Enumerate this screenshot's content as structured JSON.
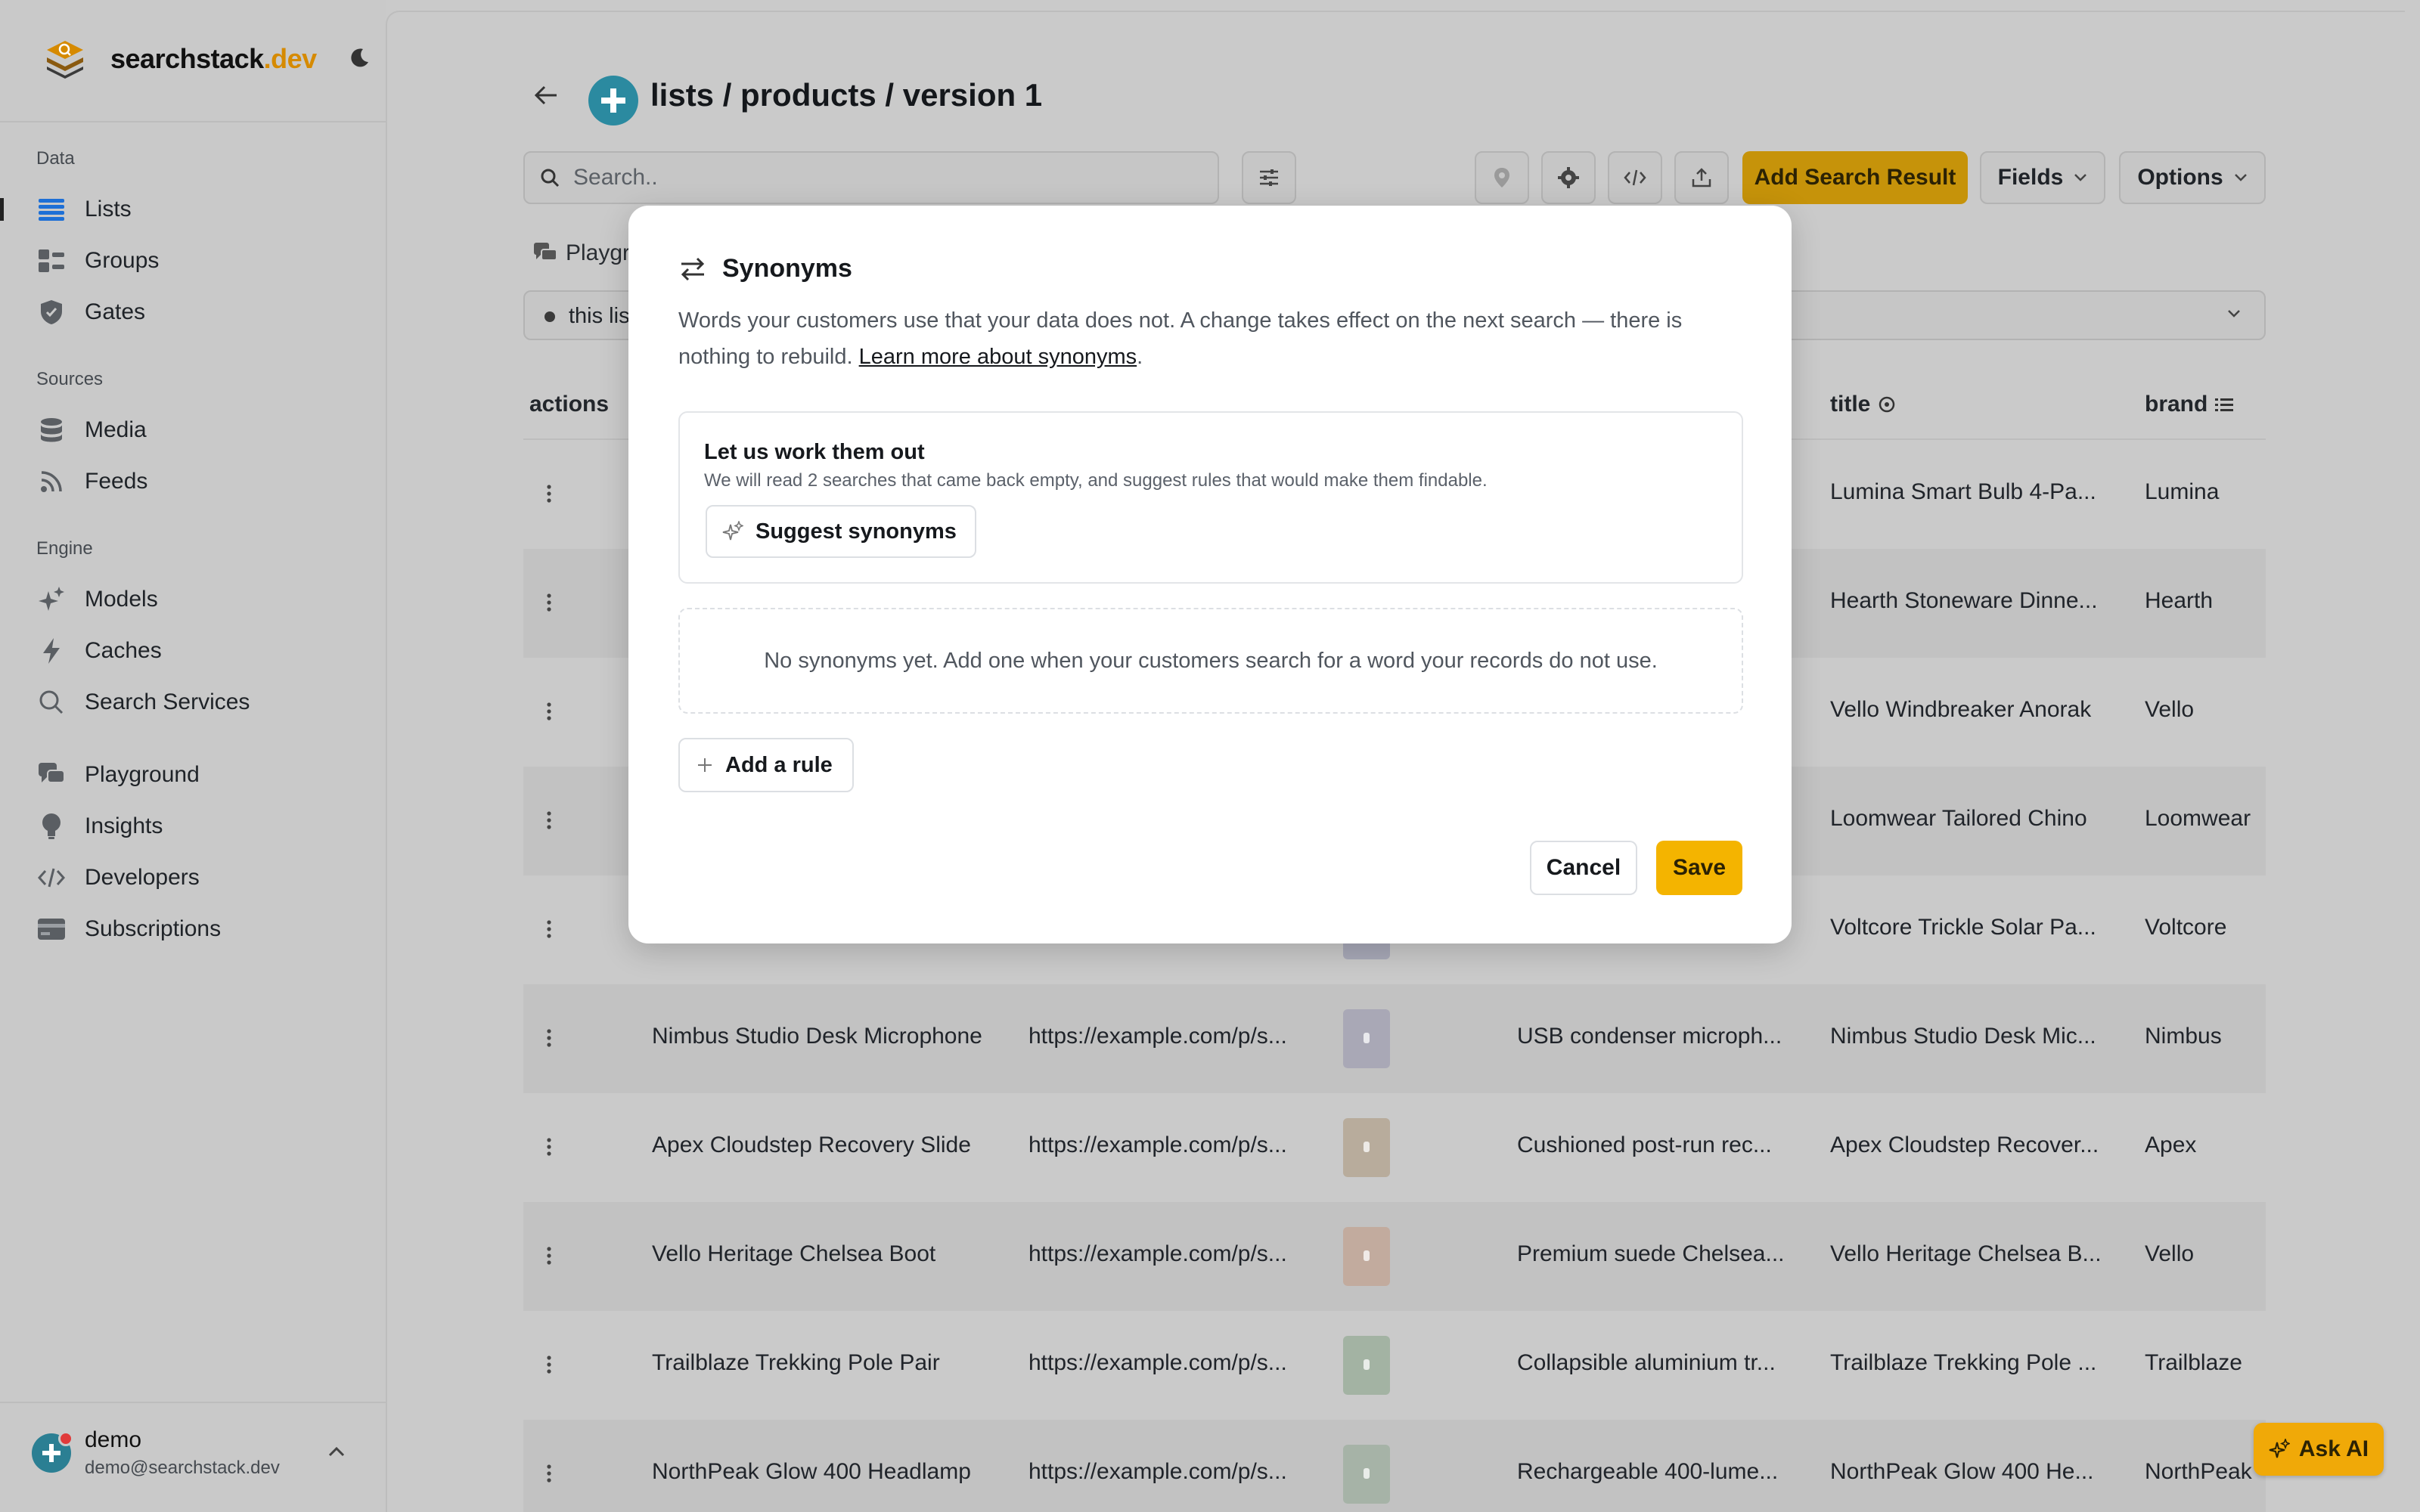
{
  "brand": {
    "name_main": "searchstack",
    "name_suffix": ".dev"
  },
  "sidebar": {
    "sections": {
      "data": "Data",
      "sources": "Sources",
      "engine": "Engine"
    },
    "items": [
      {
        "label": "Lists",
        "icon": "list-icon",
        "active": true
      },
      {
        "label": "Groups",
        "icon": "groups-icon"
      },
      {
        "label": "Gates",
        "icon": "shield-icon"
      },
      {
        "label": "Media",
        "icon": "database-icon"
      },
      {
        "label": "Feeds",
        "icon": "rss-icon"
      },
      {
        "label": "Models",
        "icon": "sparkles-icon"
      },
      {
        "label": "Caches",
        "icon": "bolt-icon"
      },
      {
        "label": "Search Services",
        "icon": "search-icon"
      },
      {
        "label": "Playground",
        "icon": "chat-icon"
      },
      {
        "label": "Insights",
        "icon": "bulb-icon"
      },
      {
        "label": "Developers",
        "icon": "code-icon"
      },
      {
        "label": "Subscriptions",
        "icon": "card-icon"
      }
    ],
    "user": {
      "name": "demo",
      "email": "demo@searchstack.dev"
    }
  },
  "header": {
    "title": "lists / products / version 1"
  },
  "toolbar": {
    "search_placeholder": "Search..",
    "add_label": "Add Search Result",
    "fields_label": "Fields",
    "options_label": "Options"
  },
  "tabs": {
    "playground_partial": "Playgr"
  },
  "filter": {
    "chip_partial": "this lis"
  },
  "table": {
    "headers": {
      "actions": "actions",
      "title": "title",
      "brand": "brand"
    },
    "rows": [
      {
        "name": "",
        "url": "",
        "desc": "",
        "title": "Lumina Smart Bulb 4-Pa...",
        "brand": "Lumina",
        "thumb": "#c7c7c7"
      },
      {
        "name": "",
        "url": "",
        "desc": "",
        "title": "Hearth Stoneware Dinne...",
        "brand": "Hearth",
        "thumb": "#c7c7c7"
      },
      {
        "name": "",
        "url": "",
        "desc": "",
        "title": "Vello Windbreaker Anorak",
        "brand": "Vello",
        "thumb": "#c7c7c7"
      },
      {
        "name": "",
        "url": "",
        "desc": "",
        "title": "Loomwear Tailored Chino",
        "brand": "Loomwear",
        "thumb": "#c7c7c7"
      },
      {
        "name": "",
        "url": "",
        "desc": "",
        "title": "Voltcore Trickle Solar Pa...",
        "brand": "Voltcore",
        "thumb": "#a8a9b8"
      },
      {
        "name": "Nimbus Studio Desk Microphone",
        "url": "https://example.com/p/s...",
        "desc": "USB condenser microph...",
        "title": "Nimbus Studio Desk Mic...",
        "brand": "Nimbus",
        "thumb": "#a9a8b6"
      },
      {
        "name": "Apex Cloudstep Recovery Slide",
        "url": "https://example.com/p/s...",
        "desc": "Cushioned post-run rec...",
        "title": "Apex Cloudstep Recover...",
        "brand": "Apex",
        "thumb": "#b8ac9c"
      },
      {
        "name": "Vello Heritage Chelsea Boot",
        "url": "https://example.com/p/s...",
        "desc": "Premium suede Chelsea...",
        "title": "Vello Heritage Chelsea B...",
        "brand": "Vello",
        "thumb": "#c2ab9e"
      },
      {
        "name": "Trailblaze Trekking Pole Pair",
        "url": "https://example.com/p/s...",
        "desc": "Collapsible aluminium tr...",
        "title": "Trailblaze Trekking Pole ...",
        "brand": "Trailblaze",
        "thumb": "#a3b3a3"
      },
      {
        "name": "NorthPeak Glow 400 Headlamp",
        "url": "https://example.com/p/s...",
        "desc": "Rechargeable 400-lume...",
        "title": "NorthPeak Glow 400 He...",
        "brand": "NorthPeak",
        "thumb": "#a6b3a7"
      }
    ]
  },
  "modal": {
    "title": "Synonyms",
    "desc": "Words your customers use that your data does not. A change takes effect on the next search — there is nothing to rebuild.",
    "learn_more": "Learn more about synonyms",
    "desc_end": ".",
    "card_heading": "Let us work them out",
    "card_sub": "We will read 2 searches that came back empty, and suggest rules that would make them findable.",
    "suggest_label": "Suggest synonyms",
    "empty_text": "No synonyms yet. Add one when your customers search for a word your records do not use.",
    "add_rule_label": "Add a rule",
    "cancel_label": "Cancel",
    "save_label": "Save"
  },
  "ask_ai": {
    "label": "Ask AI"
  },
  "colors": {
    "accent": "#f4b400",
    "brand": "#d68a00",
    "teal": "#2b8aa0"
  }
}
